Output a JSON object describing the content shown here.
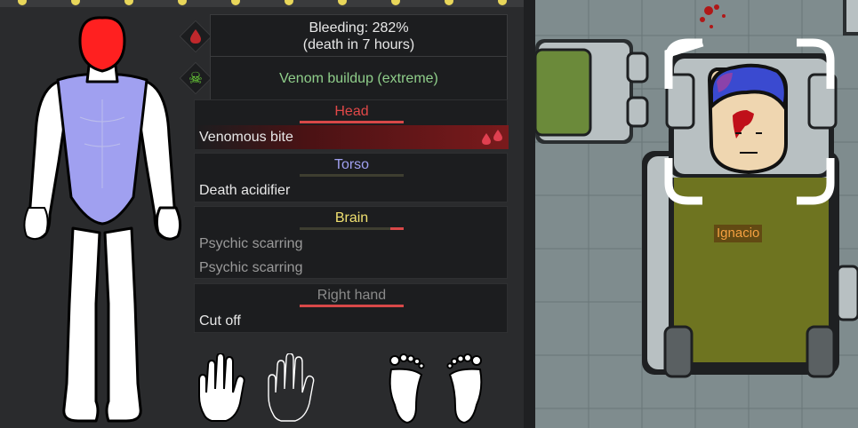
{
  "alerts": [
    {
      "icon": "blood-drop-icon",
      "line1": "Bleeding: 282%",
      "line2": "(death in 7 hours)"
    },
    {
      "icon": "skull-crossbones-icon",
      "line1": "Venom buildup (extreme)"
    }
  ],
  "parts": [
    {
      "name": "Head",
      "color": "#e04848",
      "conditions": [
        "Venomous bite"
      ]
    },
    {
      "name": "Torso",
      "color": "#a0a0f0",
      "conditions": [
        "Death acidifier"
      ]
    },
    {
      "name": "Brain",
      "color": "#f0e070",
      "conditions": [
        "Psychic scarring",
        "Psychic scarring"
      ]
    },
    {
      "name": "Right hand",
      "color": "#8a8a8a",
      "conditions": [
        "Cut off"
      ]
    }
  ],
  "limbs": [
    "left-hand-icon",
    "right-hand-missing-icon",
    "left-foot-icon",
    "right-foot-icon"
  ],
  "pawn": {
    "name": "Ignacio"
  },
  "colors": {
    "torso": "#a0a0f0",
    "head": "#ff2020",
    "bleeding": "#7a1a1c",
    "name_label": "#f4a040"
  }
}
